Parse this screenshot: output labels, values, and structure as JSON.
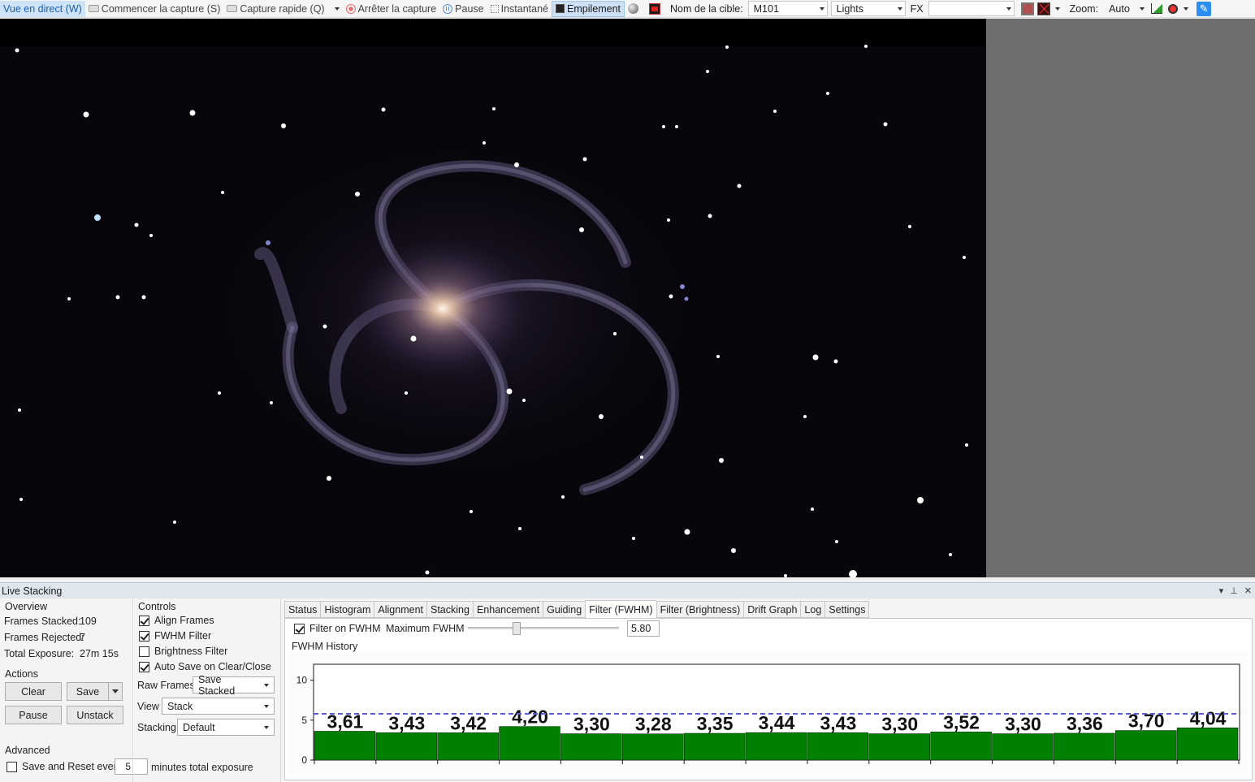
{
  "toolbar": {
    "live_view": "Vue en direct (W)",
    "start_capture": "Commencer la capture (S)",
    "quick_capture": "Capture rapide (Q)",
    "stop_capture": "Arrêter la capture",
    "pause": "Pause",
    "snapshot": "Instantané",
    "stacking": "Empilement",
    "target_label": "Nom de la cible:",
    "target_value": "M101",
    "frame_type": "Lights",
    "fx_label": "FX",
    "fx_value": "",
    "zoom_label": "Zoom:",
    "zoom_value": "Auto"
  },
  "live_stacking": {
    "title": "Live Stacking",
    "overview": {
      "title": "Overview",
      "frames_stacked_label": "Frames Stacked:",
      "frames_stacked": "109",
      "frames_rejected_label": "Frames Rejected:",
      "frames_rejected": "7",
      "total_exposure_label": "Total Exposure:",
      "total_exposure": "27m 15s"
    },
    "actions": {
      "title": "Actions",
      "clear": "Clear",
      "save": "Save",
      "pause": "Pause",
      "unstack": "Unstack"
    },
    "advanced": {
      "title": "Advanced",
      "save_reset_label": "Save and Reset every",
      "save_reset_value": "5",
      "save_reset_suffix": "minutes total exposure",
      "save_reset_checked": false
    },
    "controls": {
      "title": "Controls",
      "align_frames": "Align Frames",
      "align_frames_checked": true,
      "fwhm_filter": "FWHM Filter",
      "fwhm_filter_checked": true,
      "brightness_filter": "Brightness Filter",
      "brightness_filter_checked": false,
      "auto_save": "Auto Save on Clear/Close",
      "auto_save_checked": true,
      "raw_frames_label": "Raw Frames",
      "raw_frames_value": "Save Stacked",
      "view_label": "View",
      "view_value": "Stack",
      "stacking_label": "Stacking",
      "stacking_value": "Default"
    },
    "tabs": [
      "Status",
      "Histogram",
      "Alignment",
      "Stacking",
      "Enhancement",
      "Guiding",
      "Filter (FWHM)",
      "Filter (Brightness)",
      "Drift Graph",
      "Log",
      "Settings"
    ],
    "active_tab": "Filter (FWHM)",
    "fwhm": {
      "filter_label": "Filter on FWHM",
      "filter_checked": true,
      "max_label": "Maximum FWHM",
      "max_value": "5.80",
      "max_fraction": 0.32,
      "history_title": "FWHM History"
    }
  },
  "colors": {
    "bar_fill": "#008000",
    "threshold_line": "#5b5bd6",
    "accent": "#2c8ef0"
  },
  "chart_data": {
    "type": "bar",
    "title": "FWHM History",
    "categories": [],
    "values": [
      3.61,
      3.43,
      3.42,
      4.2,
      3.3,
      3.28,
      3.35,
      3.44,
      3.43,
      3.3,
      3.52,
      3.3,
      3.36,
      3.7,
      4.04
    ],
    "labels": [
      "3,61",
      "3,43",
      "3,42",
      "4,20",
      "3,30",
      "3,28",
      "3,35",
      "3,44",
      "3,43",
      "3,30",
      "3,52",
      "3,30",
      "3,36",
      "3,70",
      "4,04"
    ],
    "threshold": 5.8,
    "ylim": [
      0,
      12
    ],
    "yticks": [
      "0",
      "5",
      "10"
    ],
    "ytick_values": [
      0,
      5,
      10
    ],
    "xlabel": "",
    "ylabel": ""
  }
}
